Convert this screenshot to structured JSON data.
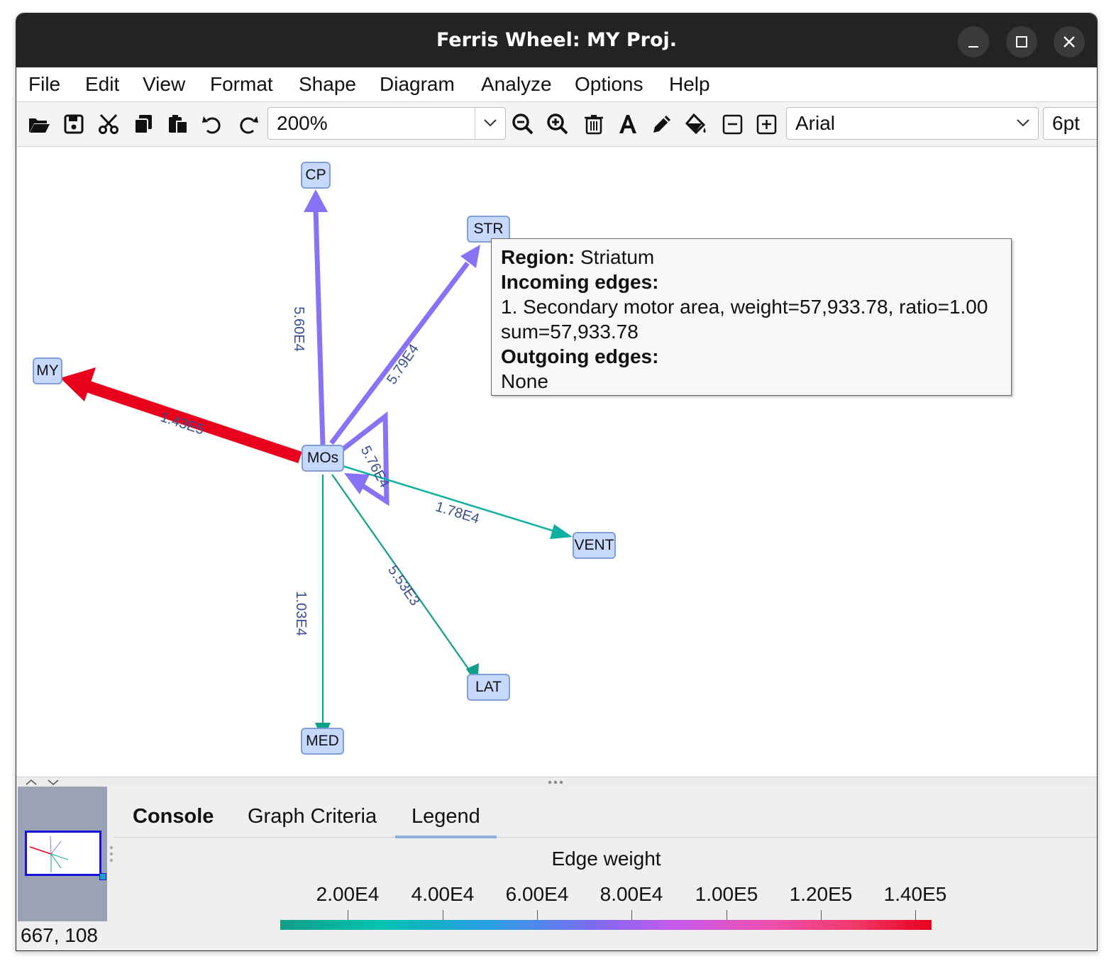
{
  "window": {
    "title": "Ferris Wheel: MY Proj."
  },
  "menu": [
    "File",
    "Edit",
    "View",
    "Format",
    "Shape",
    "Diagram",
    "Analyze",
    "Options",
    "Help"
  ],
  "toolbar": {
    "zoom_value": "200%",
    "font_value": "Arial",
    "size_value": "6pt",
    "icons": [
      "folder-open-icon",
      "save-icon",
      "cut-icon",
      "copy-icon",
      "paste-icon",
      "undo-icon",
      "redo-icon",
      "zoom-out-icon",
      "zoom-in-icon",
      "delete-icon",
      "text-icon",
      "pencil-icon",
      "fill-icon",
      "collapse-icon",
      "expand-icon"
    ]
  },
  "graph": {
    "nodes": {
      "cp": "CP",
      "str": "STR",
      "my": "MY",
      "mos": "MOs",
      "vent": "VENT",
      "lat": "LAT",
      "med": "MED"
    },
    "edges": {
      "mos_my": {
        "label": "1.43E5",
        "color": "#e8001c",
        "weight": 143000
      },
      "mos_cp": {
        "label": "5.60E4",
        "color": "#8872f5",
        "weight": 56000
      },
      "mos_str": {
        "label": "5.79E4",
        "color": "#8872f5",
        "weight": 57900
      },
      "mos_self": {
        "label": "5.76E4",
        "color": "#8872f5",
        "weight": 57600
      },
      "mos_vent": {
        "label": "1.78E4",
        "color": "#10b0a0",
        "weight": 17800
      },
      "mos_lat": {
        "label": "5.53E3",
        "color": "#0f9e88",
        "weight": 5530
      },
      "mos_med": {
        "label": "1.03E4",
        "color": "#0f9e88",
        "weight": 10300
      }
    }
  },
  "tooltip": {
    "region_label": "Region:",
    "region_value": "Striatum",
    "incoming_label": "Incoming edges:",
    "incoming_line": "1. Secondary motor area, weight=57,933.78, ratio=1.00",
    "sum_line": "sum=57,933.78",
    "outgoing_label": "Outgoing edges:",
    "outgoing_value": "None"
  },
  "bottom": {
    "tabs": [
      "Console",
      "Graph Criteria",
      "Legend"
    ],
    "active_tab": "Legend",
    "coords": "667, 108",
    "legend_title": "Edge weight",
    "ticks": [
      "2.00E4",
      "4.00E4",
      "6.00E4",
      "8.00E4",
      "1.00E5",
      "1.20E5",
      "1.40E5"
    ]
  },
  "colors": {
    "title_bg": "#232323",
    "node_fill": "#c6d8fb",
    "node_border": "#7f9fd4",
    "edge_label": "#3a4f8f"
  }
}
